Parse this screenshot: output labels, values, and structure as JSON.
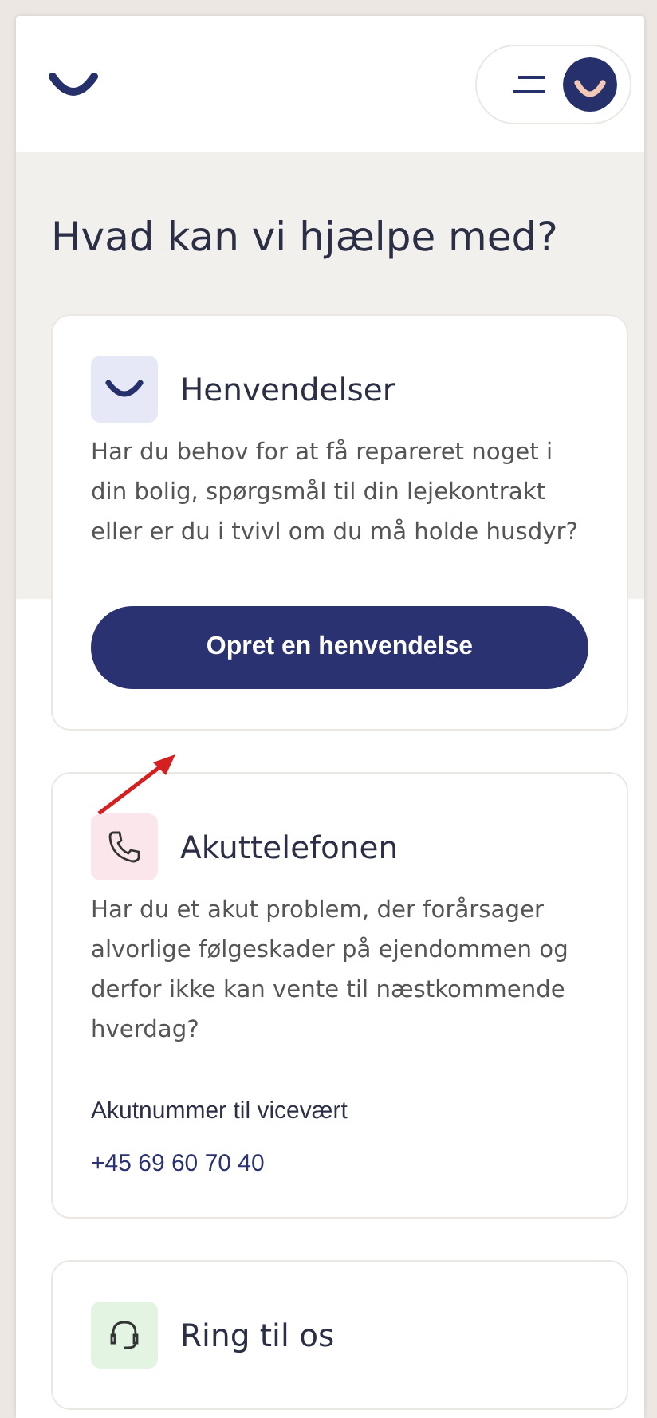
{
  "heading": "Hvad kan vi hjælpe med?",
  "cards": [
    {
      "title": "Henvendelser",
      "text": "Har du behov for at få repareret noget i din bolig, spørgsmål til din lejekontrakt eller er du i tvivl om du må holde husdyr?",
      "button": "Opret en henvendelse"
    },
    {
      "title": "Akuttelefonen",
      "text": "Har du et akut problem, der forårsager alvorlige følgeskader på ejendommen og derfor ikke kan vente til næstkommende hverdag?",
      "contact_label": "Akutnummer til vicevært",
      "contact_value": "+45 69 60 70 40"
    },
    {
      "title": "Ring til os"
    }
  ]
}
